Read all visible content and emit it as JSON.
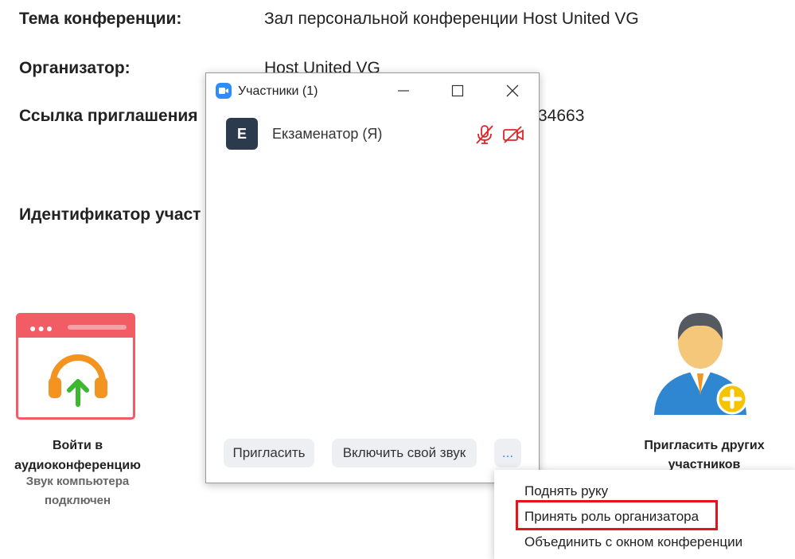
{
  "meeting_info": {
    "topic_label": "Тема конференции:",
    "topic_value": "Зал персональной конференции Host United VG",
    "host_label": "Организатор:",
    "host_value": "Host United VG",
    "invite_label": "Ссылка приглашения",
    "invite_value_suffix": "34663",
    "participant_id_label": "Идентификатор участ"
  },
  "audio_tile": {
    "line1": "Войти в",
    "line2": "аудиоконференцию",
    "status1": "Звук компьютера",
    "status2": "подключен"
  },
  "invite_tile": {
    "line1": "Пригласить других",
    "line2": "участников"
  },
  "participants_window": {
    "title": "Участники (1)",
    "participants": [
      {
        "initial": "E",
        "name": "Екзаменатор (Я)"
      }
    ],
    "buttons": {
      "invite": "Пригласить",
      "unmute": "Включить свой звук",
      "more": "..."
    }
  },
  "context_menu": {
    "items": [
      "Поднять руку",
      "Принять роль организатора",
      "Объединить с окном конференции"
    ],
    "highlighted_index": 1
  },
  "colors": {
    "accent_red": "#e3141b",
    "muted_icon": "#e0242a",
    "audio_tile": "#f25d65",
    "zoom_blue": "#2d8cff"
  }
}
